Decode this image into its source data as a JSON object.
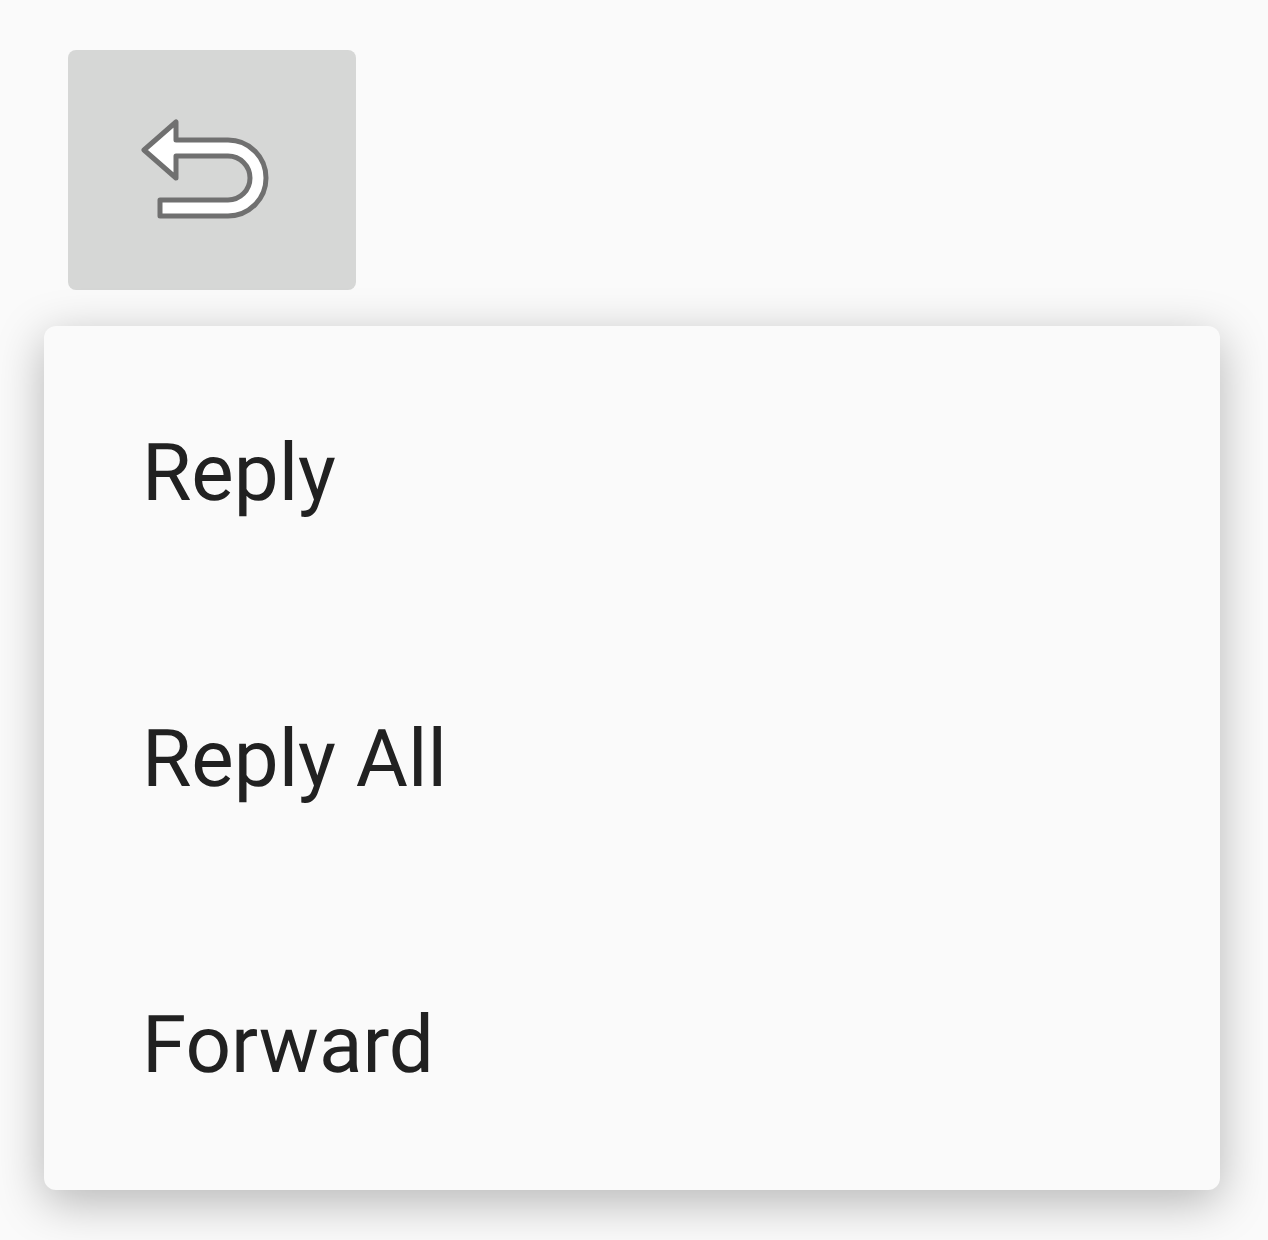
{
  "menu": {
    "items": [
      {
        "label": "Reply"
      },
      {
        "label": "Reply All"
      },
      {
        "label": "Forward"
      }
    ]
  }
}
